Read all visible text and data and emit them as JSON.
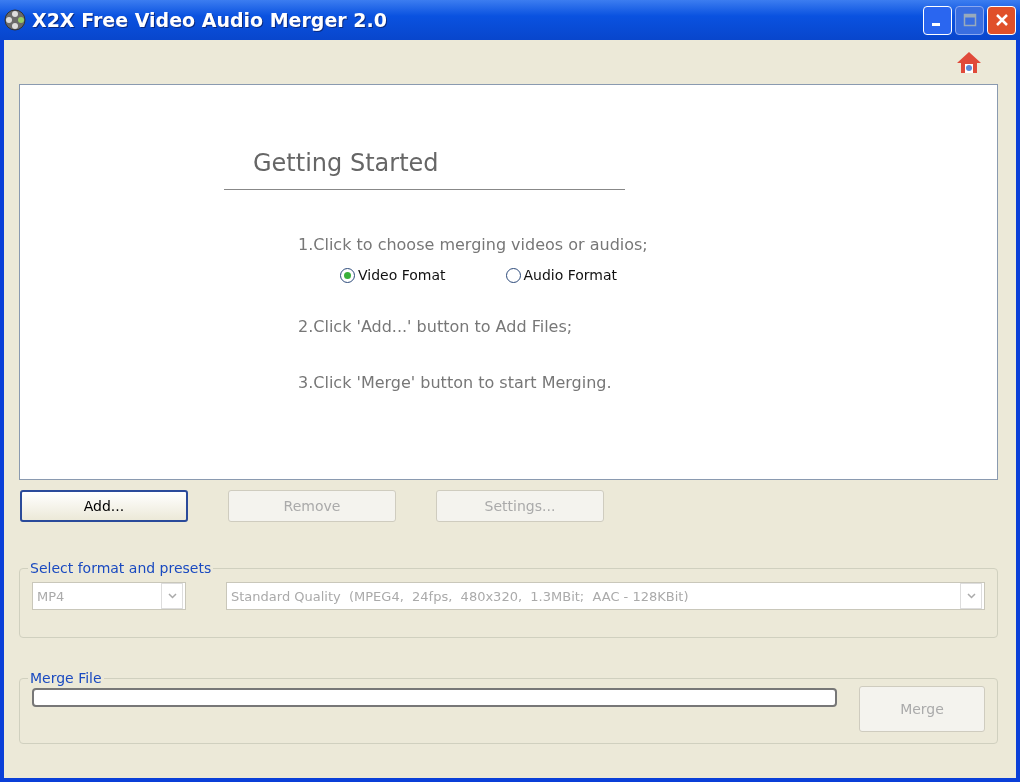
{
  "window": {
    "title": "X2X Free Video Audio Merger 2.0"
  },
  "getting_started": {
    "heading": "Getting Started",
    "instructions": [
      {
        "kind": "text",
        "text": "1.Click to choose merging videos or audios;"
      },
      {
        "kind": "radios",
        "options": [
          {
            "label": "Video Fomat",
            "selected": true
          },
          {
            "label": "Audio Format",
            "selected": false
          }
        ]
      },
      {
        "kind": "text",
        "text": "2.Click 'Add...' button to Add Files;"
      },
      {
        "kind": "text",
        "text": "3.Click 'Merge' button to start Merging."
      }
    ]
  },
  "buttons": [
    {
      "label": "Add...",
      "disabled": false,
      "focused": true
    },
    {
      "label": "Remove",
      "disabled": true,
      "focused": false
    },
    {
      "label": "Settings...",
      "disabled": true,
      "focused": false
    }
  ],
  "format_group": {
    "title": "Select format and presets",
    "format": {
      "value": "MP4",
      "disabled": true
    },
    "preset": {
      "value": "Standard Quality  (MPEG4,  24fps,  480x320,  1.3MBit;  AAC - 128KBit)",
      "disabled": true
    }
  },
  "merge_group": {
    "title": "Merge File",
    "progress": {
      "level": 0
    },
    "button": {
      "label": "Merge",
      "disabled": true
    }
  }
}
